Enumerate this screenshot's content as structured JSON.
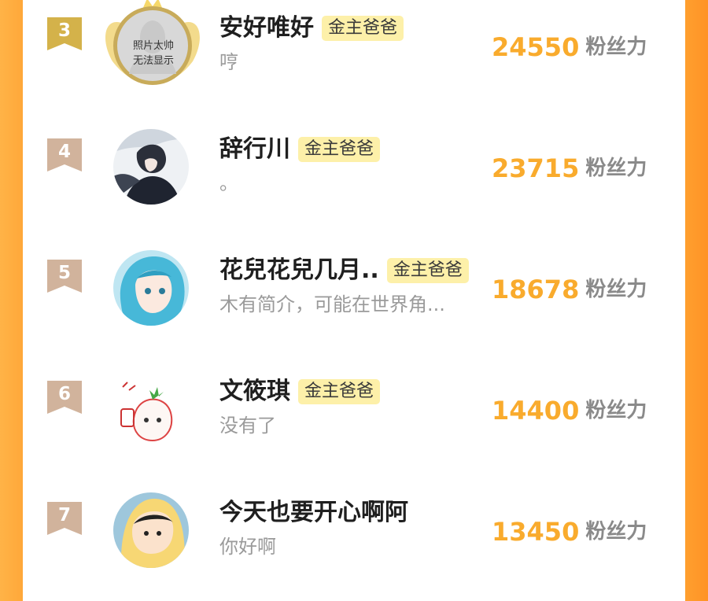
{
  "leaderboard": [
    {
      "rank": "3",
      "name": "安好唯好",
      "badge": "金主爸爸",
      "bio": "哼",
      "score": "24550",
      "unit": "粉丝力",
      "avatar_text_1": "照片太帅",
      "avatar_text_2": "无法显示",
      "rank_color": "#d4b24a"
    },
    {
      "rank": "4",
      "name": "辞行川",
      "badge": "金主爸爸",
      "bio": "。",
      "score": "23715",
      "unit": "粉丝力",
      "rank_color": "#d1b39c"
    },
    {
      "rank": "5",
      "name": "花兒花兒几月..",
      "badge": "金主爸爸",
      "bio": "木有简介，可能在世界角...",
      "score": "18678",
      "unit": "粉丝力",
      "rank_color": "#d1b39c"
    },
    {
      "rank": "6",
      "name": "文筱琪",
      "badge": "金主爸爸",
      "bio": "没有了",
      "score": "14400",
      "unit": "粉丝力",
      "rank_color": "#d1b39c"
    },
    {
      "rank": "7",
      "name": "今天也要开心啊阿",
      "badge": "",
      "bio": "你好啊",
      "score": "13450",
      "unit": "粉丝力",
      "rank_color": "#d1b39c"
    }
  ],
  "colors": {
    "score": "#f9ab2d",
    "badge_bg": "#fdf0a9",
    "side_orange": "#ffa83a"
  },
  "icons": [
    "rank-ribbon-icon",
    "crown-wings-icon"
  ]
}
